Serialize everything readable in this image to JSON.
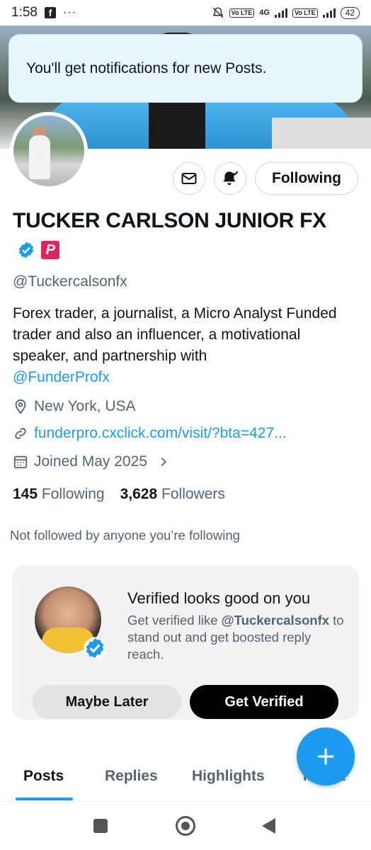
{
  "status_bar": {
    "time": "1:58",
    "dots": "···",
    "battery": "42",
    "network": "4G",
    "volte1": "Vo LTE",
    "volte2": "Vo LTE"
  },
  "toast": {
    "text": "You'll get notifications for new Posts."
  },
  "actions": {
    "following_label": "Following"
  },
  "profile": {
    "name": "TUCKER CARLSON JUNIOR FX",
    "p_badge": "P",
    "handle": "@Tuckercalsonfx",
    "bio_text": "Forex trader, a journalist, a Micro Analyst Funded trader and also an influencer, a motivational speaker, and partnership with",
    "bio_mention": "@FunderProfx",
    "location": "New York, USA",
    "website": "funderpro.cxclick.com/visit/?bta=427...",
    "joined": "Joined May 2025",
    "following_count": "145",
    "following_label": "Following",
    "followers_count": "3,628",
    "followers_label": "Followers",
    "not_followed": "Not followed by anyone you’re following"
  },
  "verified_card": {
    "title": "Verified looks good on you",
    "desc_prefix": "Get verified like ",
    "desc_handle": "@Tuckercalsonfx",
    "desc_suffix": " to stand out and get boosted reply reach.",
    "maybe_label": "Maybe Later",
    "get_label": "Get Verified"
  },
  "tabs": [
    {
      "label": "Posts"
    },
    {
      "label": "Replies"
    },
    {
      "label": "Highlights"
    },
    {
      "label": "Media"
    }
  ],
  "colors": {
    "accent": "#1d9bf0",
    "toast_bg": "#e8f6fd",
    "card_bg": "#f2f2f2",
    "p_badge": "#e0245e"
  }
}
